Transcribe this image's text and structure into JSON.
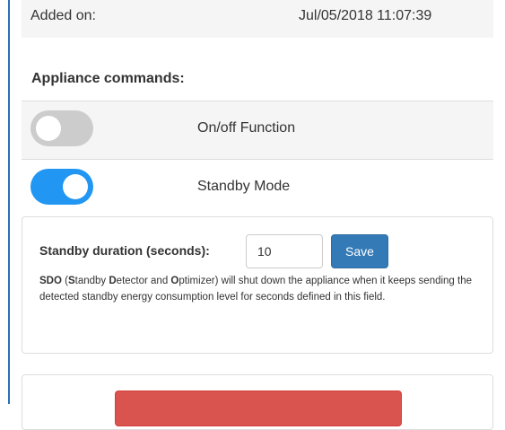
{
  "info": {
    "added_label": "Added on:",
    "added_value": "Jul/05/2018 11:07:39"
  },
  "commands": {
    "heading": "Appliance commands:",
    "items": [
      {
        "label": "On/off Function",
        "state": "off"
      },
      {
        "label": "Standby Mode",
        "state": "on"
      }
    ]
  },
  "standby": {
    "duration_label": "Standby duration (seconds):",
    "duration_value": "10",
    "save_label": "Save",
    "help_segments": [
      "SDO",
      " (",
      "S",
      "tandby ",
      "D",
      "etector and ",
      "O",
      "ptimizer) will shut down the appliance when it keeps sending the detected standby energy consumption level for seconds defined in this field."
    ]
  },
  "colors": {
    "accent": "#2196f3",
    "primary_button": "#337ab7",
    "danger_button": "#d9534f",
    "side_rule": "#2d6fb5"
  }
}
